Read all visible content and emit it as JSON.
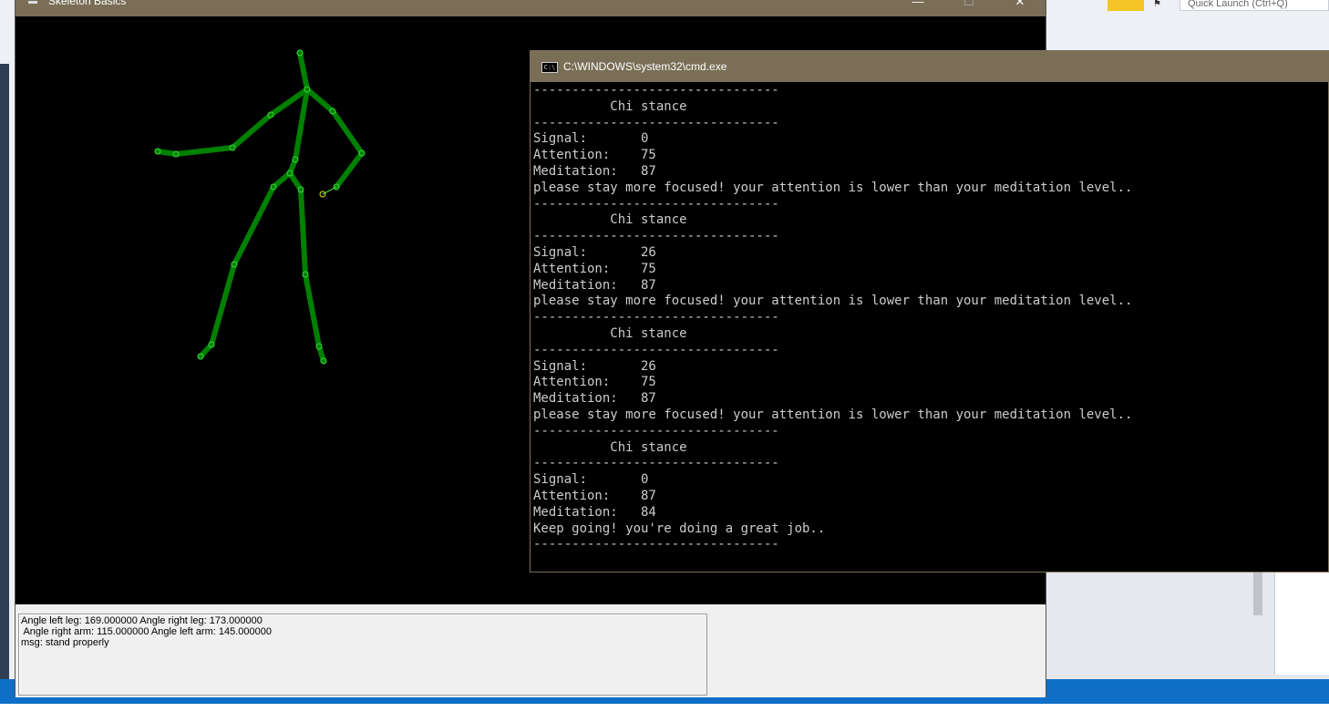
{
  "background": {
    "quick_launch_placeholder": "Quick Launch (Ctrl+Q)",
    "flag_icon": "flag-icon"
  },
  "skeleton_window": {
    "title": "Skeleton Basics",
    "minimize_label": "—",
    "maximize_label": "☐",
    "close_label": "✕",
    "status_lines": [
      "Angle left leg: 169.000000 Angle right leg: 173.000000",
      " Angle right arm: 115.000000 Angle left arm: 145.000000",
      "msg: stand properly"
    ],
    "colors": {
      "bone": "#008000",
      "joint": "#3cdc3c",
      "highlight_joint": "#e6e60a"
    }
  },
  "cmd_window": {
    "title": "C:\\WINDOWS\\system32\\cmd.exe",
    "lines": [
      "--------------------------------",
      "          Chi stance",
      "--------------------------------",
      "Signal:       0",
      "Attention:    75",
      "Meditation:   87",
      "please stay more focused! your attention is lower than your meditation level..",
      "--------------------------------",
      "          Chi stance",
      "--------------------------------",
      "Signal:       26",
      "Attention:    75",
      "Meditation:   87",
      "please stay more focused! your attention is lower than your meditation level..",
      "--------------------------------",
      "          Chi stance",
      "--------------------------------",
      "Signal:       26",
      "Attention:    75",
      "Meditation:   87",
      "please stay more focused! your attention is lower than your meditation level..",
      "--------------------------------",
      "          Chi stance",
      "--------------------------------",
      "Signal:       0",
      "Attention:    87",
      "Meditation:   84",
      "Keep going! you're doing a great job..",
      "--------------------------------"
    ]
  }
}
